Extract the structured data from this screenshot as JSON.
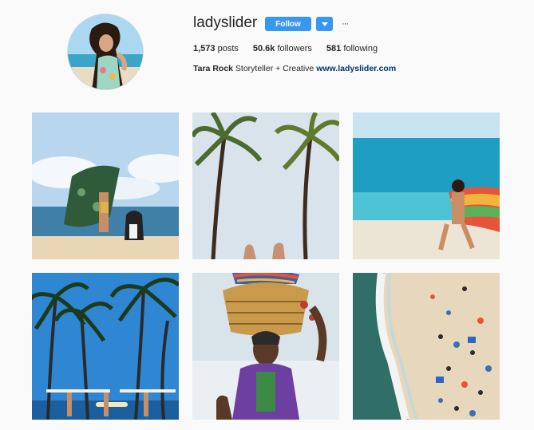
{
  "profile": {
    "username": "ladyslider",
    "follow_label": "Follow",
    "more_label": "···",
    "stats": {
      "posts_count": "1,573",
      "posts_label": "posts",
      "followers_count": "50.6k",
      "followers_label": "followers",
      "following_count": "581",
      "following_label": "following"
    },
    "bio": {
      "name": "Tara Rock",
      "text": "Storyteller + Creative",
      "link": "www.ladyslider.com"
    }
  },
  "colors": {
    "accent": "#3897f0",
    "link": "#003569",
    "background": "#fafafa"
  },
  "posts": [
    {
      "subject": "woman-holding-towel-beach-with-dog"
    },
    {
      "subject": "palm-trees-shaka-hands"
    },
    {
      "subject": "woman-running-rainbow-towel-ocean"
    },
    {
      "subject": "palm-trees-surfers"
    },
    {
      "subject": "woman-carrying-basket-on-head"
    },
    {
      "subject": "aerial-beach-crowd"
    }
  ]
}
